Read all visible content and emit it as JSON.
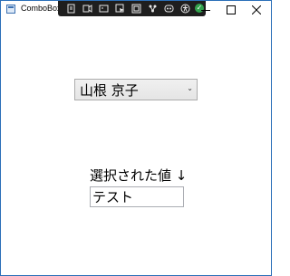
{
  "window": {
    "title": "ComboBox",
    "app_icon": "window-app-icon",
    "controls": [
      "minimize-icon",
      "maximize-icon",
      "close-icon"
    ]
  },
  "dev_toolbar": {
    "icons": [
      "ui-debugger-icon",
      "live-visual-tree-icon",
      "record-icon",
      "select-element-icon",
      "display-layout-adorners-icon",
      "track-focus-icon",
      "binding-failures-icon",
      "accessibility-icon",
      "check-icon"
    ]
  },
  "combo": {
    "selected": "山根 京子",
    "arrow_icon": "chevron-down-icon"
  },
  "selected_label": "選択された値 ↓",
  "textbox": {
    "value": "テスト"
  },
  "colors": {
    "window_border": "#2b6fb8",
    "dev_toolbar_bg": "#1e1e1e",
    "check_green": "#31a24c"
  }
}
